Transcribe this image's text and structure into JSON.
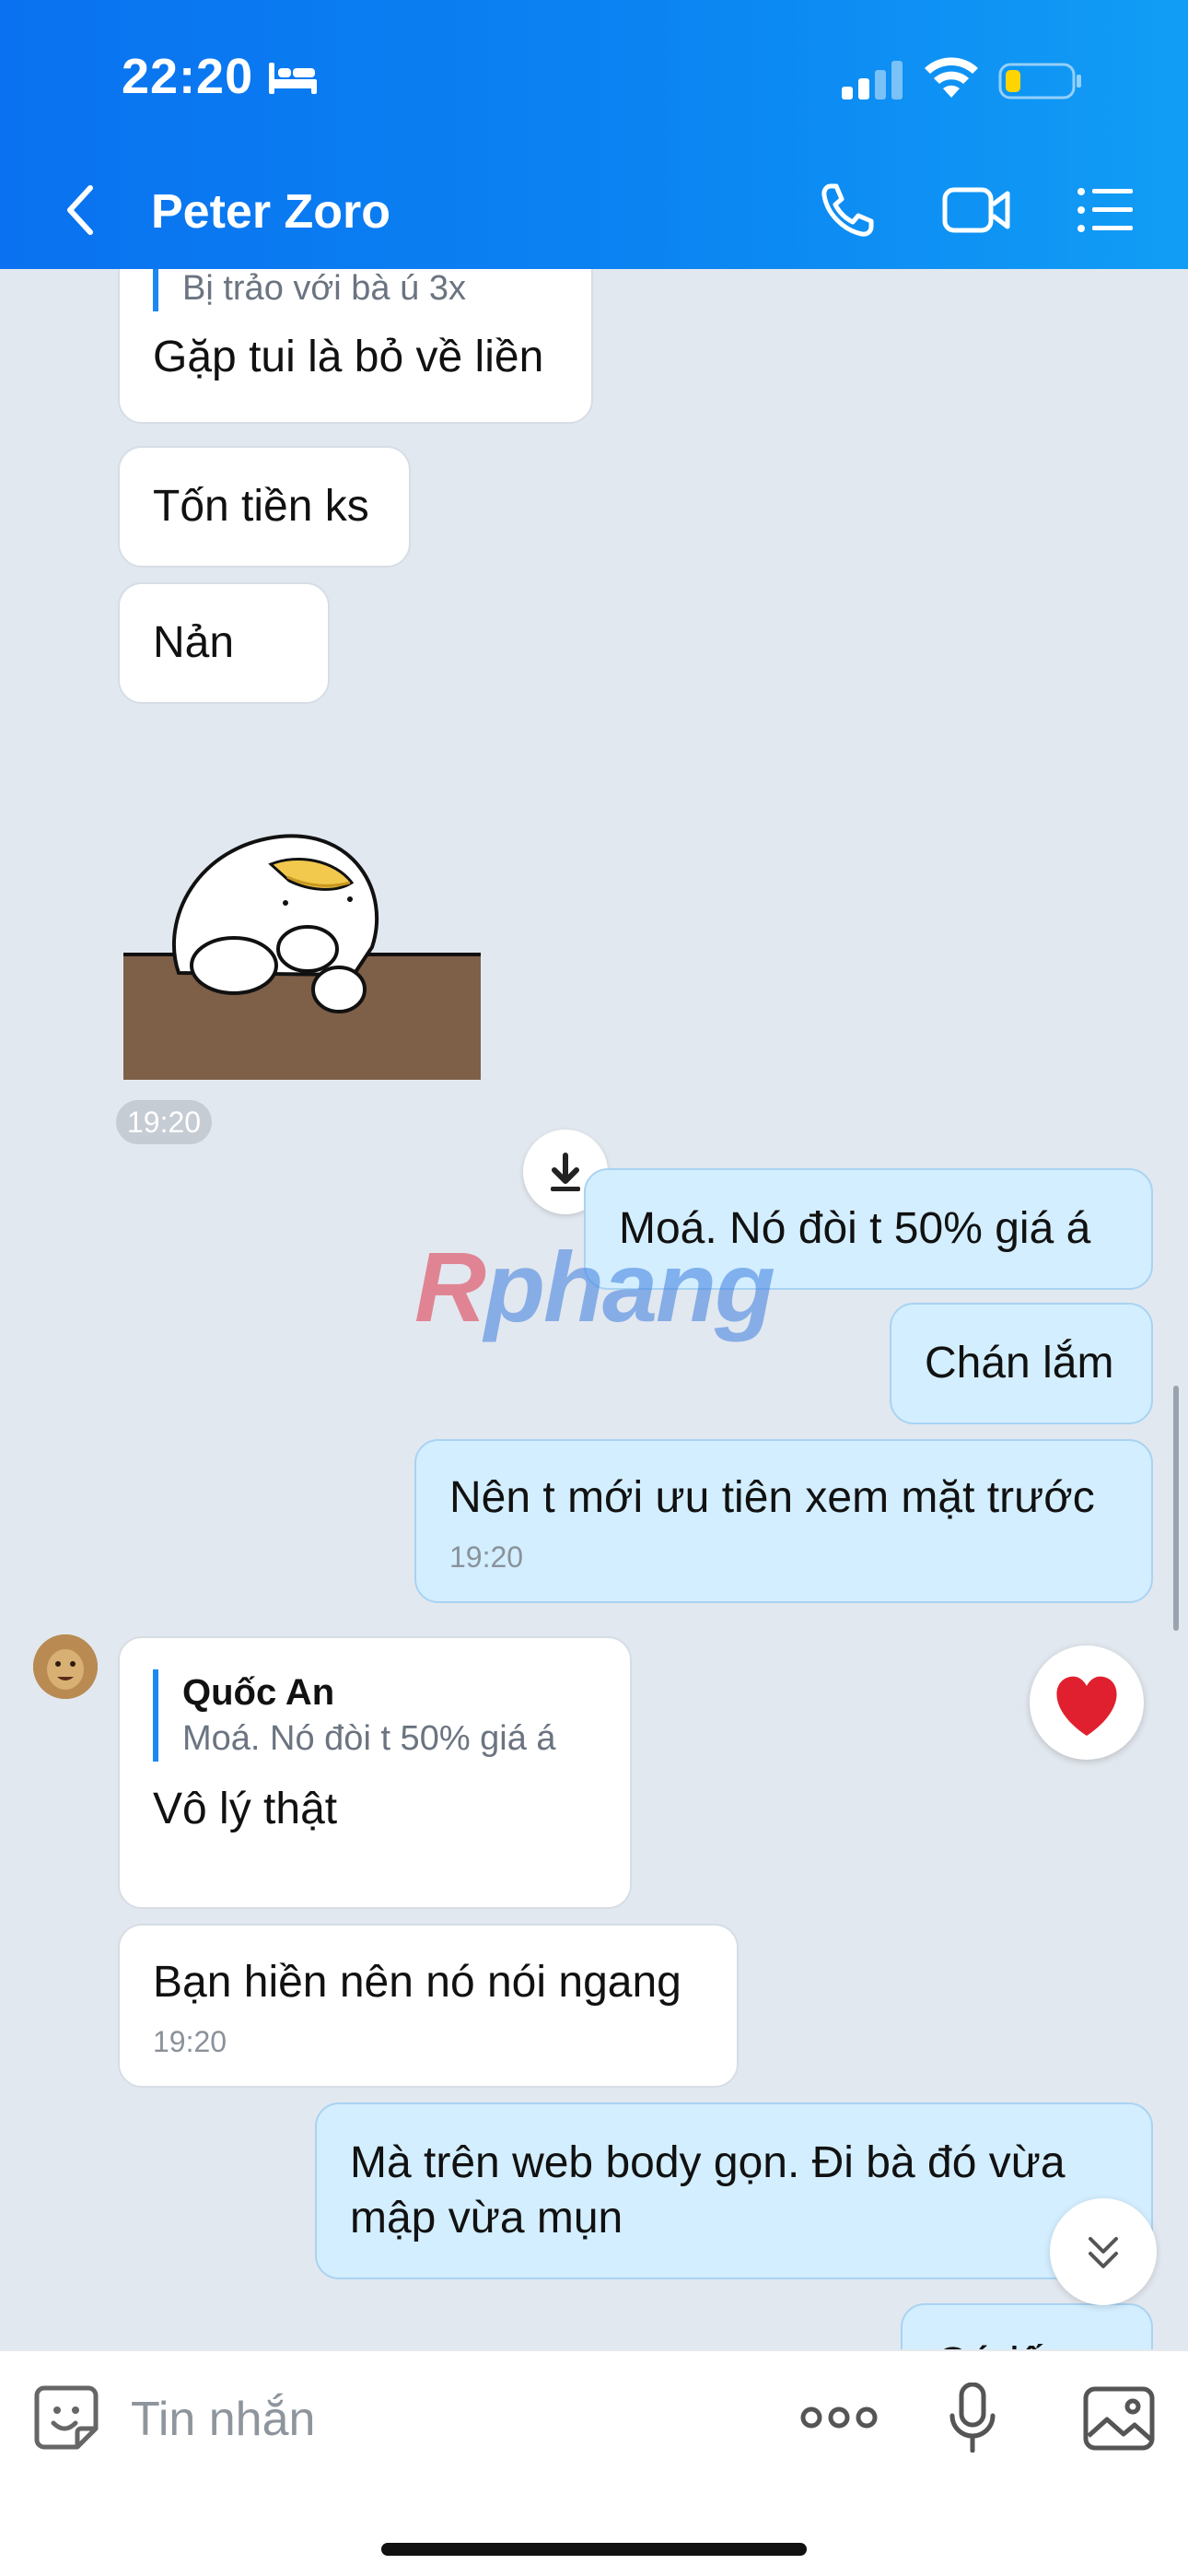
{
  "status_bar": {
    "time": "22:20",
    "sleep_icon": "bed-icon",
    "signal_icon": "cellular-signal-icon",
    "wifi_icon": "wifi-icon",
    "battery_icon": "battery-low-icon"
  },
  "header": {
    "title": "Peter Zoro",
    "back_icon": "chevron-left-icon",
    "call_icon": "phone-icon",
    "video_icon": "video-camera-icon",
    "menu_icon": "list-menu-icon"
  },
  "messages": [
    {
      "direction": "in",
      "partial_quote": "Bị trảo với bà ú 3x",
      "text": "Gặp tui là bỏ về liền"
    },
    {
      "direction": "in",
      "text": "Tốn tiền ks"
    },
    {
      "direction": "in",
      "text": "Nản"
    },
    {
      "direction": "in",
      "type": "sticker",
      "sticker_icon": "sad-bird-on-table-sticker",
      "time": "19:20"
    },
    {
      "direction": "out",
      "text": "Moá. Nó đòi t 50% giá á"
    },
    {
      "direction": "out",
      "text": "Chán lắm"
    },
    {
      "direction": "out",
      "text": "Nên t mới ưu tiên xem mặt trước",
      "time": "19:20"
    },
    {
      "direction": "in",
      "reply_to": {
        "name": "Quốc An",
        "text": "Moá. Nó đòi t 50% giá á"
      },
      "text": "Vô lý thật"
    },
    {
      "direction": "in",
      "text": "Bạn hiền nên nó nói ngang",
      "time": "19:20"
    },
    {
      "direction": "out",
      "text": "Mà trên web body gọn. Đi bà đó vừa mập vừa mụn"
    },
    {
      "direction": "out",
      "partial_text": "Cứ  lố"
    }
  ],
  "watermark": {
    "first": "R",
    "rest": "phang"
  },
  "reaction": {
    "icon": "heart-icon",
    "color": "#e0202e"
  },
  "input": {
    "placeholder": "Tin nhắn",
    "sticker_icon": "sticker-smile-icon",
    "more_icon": "more-dots-icon",
    "mic_icon": "microphone-icon",
    "image_icon": "image-icon"
  },
  "colors": {
    "header_start": "#0a72f0",
    "header_end": "#119df5",
    "outgoing_bubble": "#d3eeff",
    "incoming_bubble": "#ffffff",
    "background": "#e2e8ef"
  }
}
